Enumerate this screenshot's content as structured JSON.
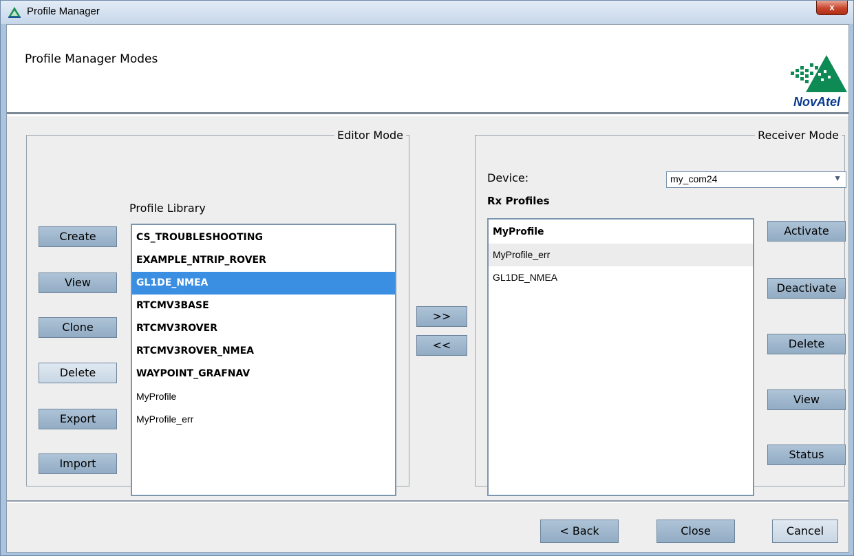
{
  "window": {
    "title": "Profile Manager",
    "close_label": "x"
  },
  "header": {
    "title": "Profile Manager Modes",
    "logo_text": "NovAtel"
  },
  "editor": {
    "legend": "Editor Mode",
    "library_label": "Profile Library",
    "buttons": {
      "create": "Create",
      "view": "View",
      "clone": "Clone",
      "delete": "Delete",
      "export": "Export",
      "import": "Import"
    },
    "profiles": [
      {
        "name": "CS_TROUBLESHOOTING",
        "bold": true,
        "selected": false
      },
      {
        "name": "EXAMPLE_NTRIP_ROVER",
        "bold": true,
        "selected": false
      },
      {
        "name": "GL1DE_NMEA",
        "bold": true,
        "selected": true
      },
      {
        "name": "RTCMV3BASE",
        "bold": true,
        "selected": false
      },
      {
        "name": "RTCMV3ROVER",
        "bold": true,
        "selected": false
      },
      {
        "name": "RTCMV3ROVER_NMEA",
        "bold": true,
        "selected": false
      },
      {
        "name": "WAYPOINT_GRAFNAV",
        "bold": true,
        "selected": false
      },
      {
        "name": "MyProfile",
        "bold": false,
        "selected": false
      },
      {
        "name": "MyProfile_err",
        "bold": false,
        "selected": false
      }
    ]
  },
  "transfer": {
    "to_receiver": ">>",
    "to_library": "<<"
  },
  "receiver": {
    "legend": "Receiver Mode",
    "device_label": "Device:",
    "device_value": "my_com24",
    "rx_label": "Rx Profiles",
    "buttons": {
      "activate": "Activate",
      "deactivate": "Deactivate",
      "delete": "Delete",
      "view": "View",
      "status": "Status"
    },
    "profiles": [
      {
        "name": "MyProfile",
        "bold": true,
        "hover": false
      },
      {
        "name": "MyProfile_err",
        "bold": false,
        "hover": true
      },
      {
        "name": "GL1DE_NMEA",
        "bold": false,
        "hover": false
      }
    ]
  },
  "footer": {
    "back": "< Back",
    "close": "Close",
    "cancel": "Cancel"
  },
  "colors": {
    "selection": "#3b8fe3",
    "button": "#a3b9cf",
    "logo_green": "#0e8a55",
    "logo_blue": "#0b3a8c"
  }
}
